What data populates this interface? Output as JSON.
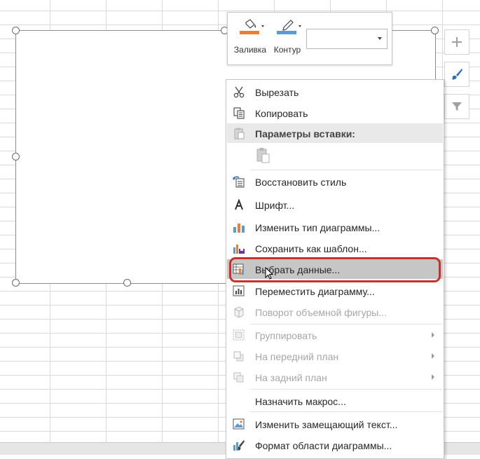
{
  "mini_toolbar": {
    "fill_label": "Заливка",
    "outline_label": "Контур",
    "combo_value": ""
  },
  "colors": {
    "fill_accent": "#ed7d31",
    "outline_accent": "#5b9bd5",
    "highlight_ring": "#c9302c"
  },
  "context_menu": {
    "cut": "Вырезать",
    "copy": "Копировать",
    "paste_options": "Параметры вставки:",
    "reset_style": "Восстановить стиль",
    "font": "Шрифт...",
    "change_chart_type": "Изменить тип диаграммы...",
    "save_as_template": "Сохранить как шаблон...",
    "select_data": "Выбрать данные...",
    "move_chart": "Переместить диаграмму...",
    "rotate_3d": "Поворот объемной фигуры...",
    "group": "Группировать",
    "bring_to_front": "На передний план",
    "send_to_back": "На задний план",
    "assign_macro": "Назначить макрос...",
    "edit_alt_text": "Изменить замещающий текст...",
    "format_chart_area": "Формат области диаграммы..."
  }
}
